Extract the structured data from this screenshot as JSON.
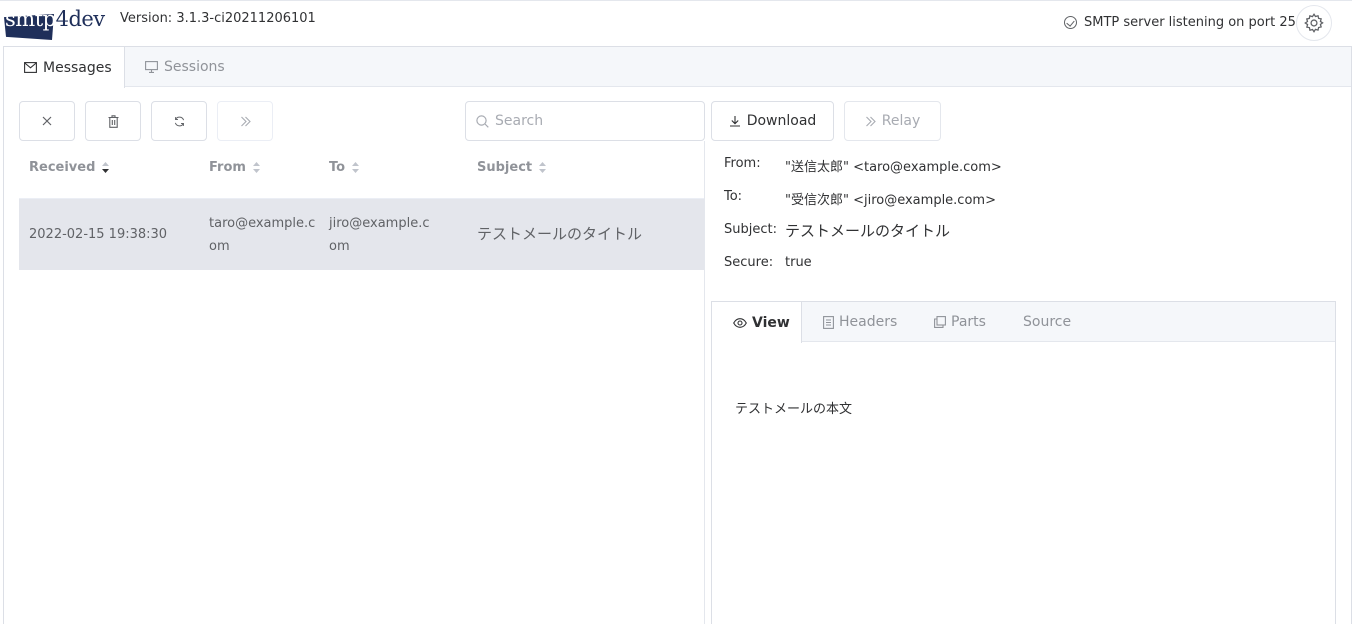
{
  "header": {
    "logo_text": "smtp4dev",
    "version": "Version: 3.1.3-ci20211206101",
    "status": "SMTP server listening on port 25"
  },
  "main_tabs": [
    {
      "label": "Messages",
      "icon": "envelope-icon",
      "active": true
    },
    {
      "label": "Sessions",
      "icon": "monitor-icon",
      "active": false
    }
  ],
  "toolbar": {
    "buttons": [
      {
        "name": "close",
        "icon": "close-icon"
      },
      {
        "name": "delete",
        "icon": "trash-icon"
      },
      {
        "name": "refresh",
        "icon": "refresh-icon"
      },
      {
        "name": "relay",
        "icon": "double-chevron-right-icon",
        "disabled": true
      }
    ],
    "search_placeholder": "Search"
  },
  "table": {
    "columns": [
      "Received",
      "From",
      "To",
      "Subject"
    ],
    "rows": [
      {
        "received": "2022-02-15 19:38:30",
        "from": "taro@example.com",
        "to": "jiro@example.com",
        "subject": "テストメールのタイトル"
      }
    ]
  },
  "detail": {
    "download_label": "Download",
    "relay_label": "Relay",
    "from_label": "From:",
    "from_value": "\"送信太郎\" <taro@example.com>",
    "to_label": "To:",
    "to_value": "\"受信次郎\" <jiro@example.com>",
    "subject_label": "Subject:",
    "subject_value": "テストメールのタイトル",
    "secure_label": "Secure:",
    "secure_value": "true",
    "tabs": [
      {
        "label": "View",
        "icon": "eye-icon",
        "active": true
      },
      {
        "label": "Headers",
        "icon": "document-icon",
        "active": false
      },
      {
        "label": "Parts",
        "icon": "copy-icon",
        "active": false
      },
      {
        "label": "Source",
        "icon": "",
        "active": false
      }
    ],
    "body": "テストメールの本文"
  },
  "colors": {
    "selected_row": "#e4e6ec",
    "logo_navy": "#1f2f5a",
    "border": "#dcdfe6"
  }
}
